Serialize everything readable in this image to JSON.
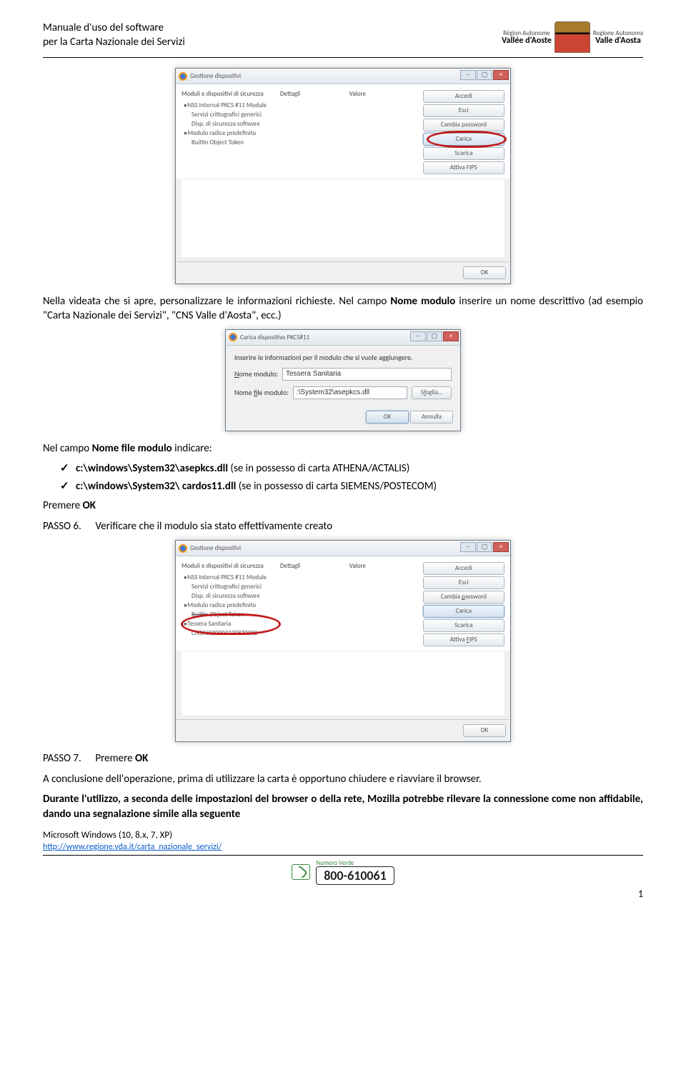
{
  "header": {
    "title_line1": "Manuale d'uso del software",
    "title_line2": "per la Carta Nazionale dei Servizi",
    "region_label_fr": "Région Autonome",
    "region_name_fr": "Vallée d'Aoste",
    "region_label_it": "Regione Autonoma",
    "region_name_it": "Valle d'Aosta"
  },
  "devmgr": {
    "window_title": "Gestione dispositivi",
    "cols": {
      "left": "Moduli e dispositivi di sicurezza",
      "mid_a": "Dettagli",
      "mid_b": "Valore"
    },
    "tree": {
      "nss": "NSS Internal PKCS #11 Module",
      "serv": "Servizi crittografici generici",
      "disp": "Disp. di sicurezza software",
      "root": "Modulo radice predefinito",
      "builtin": "Builtin Object Token",
      "tessera": "Tessera Sanitaria",
      "cns": "CNS#6020000270870002"
    },
    "buttons": {
      "accedi": "Accedi",
      "esci": "Esci",
      "cambia": "Cambia password",
      "carica": "Carica",
      "scarica": "Scarica",
      "fips": "Attiva FIPS",
      "ok": "OK"
    }
  },
  "pkcs": {
    "window_title": "Carica dispositivo PKCS#11",
    "prompt": "Inserire le informazioni per il modulo che si vuole aggiungere.",
    "name_label": "Nome modulo:",
    "name_value": "Tessera Sanitaria",
    "file_label": "Nome file modulo:",
    "file_value": ":\\System32\\asepkcs.dll",
    "browse": "Sfoglia…",
    "ok": "OK",
    "cancel": "Annulla"
  },
  "body": {
    "p1_a": "Nella videata che si apre, personalizzare le informazioni richieste. Nel campo ",
    "p1_b": "Nome modulo",
    "p1_c": " inserire un nome descrittivo (ad esempio \"Carta Nazionale dei Servizi\", \"CNS Valle d'Aosta\", ecc.)",
    "p2": "Nel campo ",
    "p2_b": "Nome file modulo",
    "p2_c": " indicare:",
    "li1_a": "c:\\windows\\System32\\asepkcs.dll",
    "li1_b": " (se in possesso di carta ATHENA/ACTALIS)",
    "li2_a": "c:\\windows\\System32\\ cardos11.dll",
    "li2_b": " (se in possesso di carta SIEMENS/POSTECOM)",
    "press_ok": "Premere ",
    "ok_bold": "OK",
    "step6_label": "PASSO 6.",
    "step6_text": "Verificare che il modulo sia stato effettivamente creato",
    "step7_label": "PASSO 7.",
    "step7_text": "Premere ",
    "step7_ok": "OK",
    "conclusion": "A conclusione dell'operazione, prima di utilizzare la carta è opportuno chiudere e riavviare il browser.",
    "warn": "Durante l'utilizzo, a seconda delle impostazioni del browser o della rete, Mozilla potrebbe rilevare la connessione come non affidabile, dando una segnalazione simile alla seguente"
  },
  "footer": {
    "os": "Microsoft Windows (10, 8.x, 7, XP)",
    "url": "http://www.regione.vda.it/carta_nazionale_servizi/",
    "hotline_label": "Numero Verde",
    "hotline_number": "800-610061",
    "page": "1"
  }
}
